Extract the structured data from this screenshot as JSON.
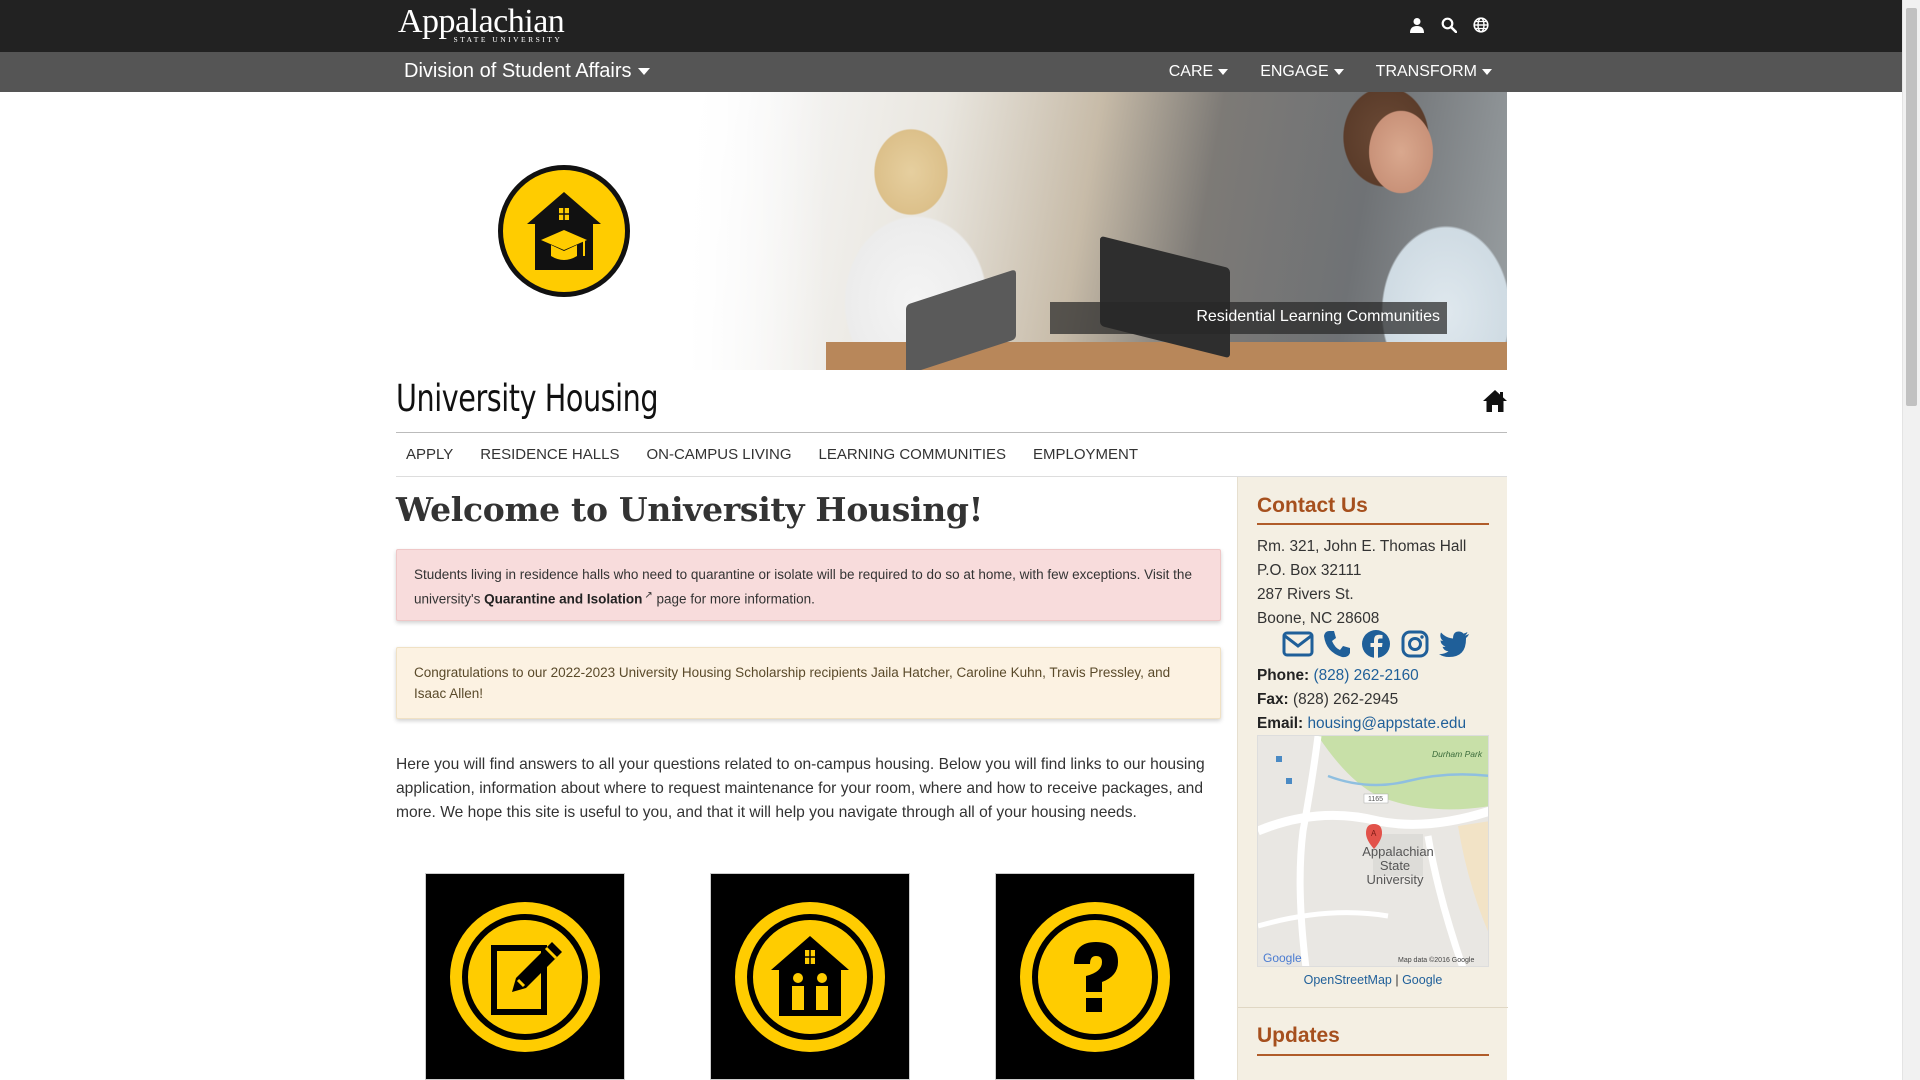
{
  "topbar": {
    "logo_text": "Appalachian",
    "logo_subtext": "STATE UNIVERSITY",
    "icons": [
      "user-icon",
      "search-icon",
      "globe-icon"
    ]
  },
  "division_bar": {
    "title": "Division of Student Affairs",
    "nav": [
      {
        "label": "CARE"
      },
      {
        "label": "ENGAGE"
      },
      {
        "label": "TRANSFORM"
      }
    ]
  },
  "banner": {
    "caption": "Residential Learning Communities"
  },
  "site": {
    "title": "University Housing"
  },
  "subnav": [
    {
      "label": "APPLY"
    },
    {
      "label": "RESIDENCE HALLS"
    },
    {
      "label": "ON-CAMPUS LIVING"
    },
    {
      "label": "LEARNING COMMUNITIES"
    },
    {
      "label": "EMPLOYMENT"
    }
  ],
  "main": {
    "heading": "Welcome to University Housing!",
    "alert_red": {
      "text_before": "Students living in residence halls who need to quarantine or isolate will be required to do so at home, with few exceptions. Visit the university's ",
      "link": "Quarantine and Isolation",
      "text_after": " page for more information."
    },
    "alert_yellow": {
      "text": "Congratulations to our 2022-2023 University Housing Scholarship recipients Jaila Hatcher, Caroline Kuhn, Travis Pressley, and Isaac Allen!"
    },
    "intro": "Here you will find answers to all your questions related to on-campus housing.  Below you will find links to our housing application, information about where to request maintenance for your room, where and how to receive packages, and more. We hope this site is useful to you, and that it will help you navigate through all of your housing needs.",
    "tiles": [
      "apply-tile-icon",
      "residence-tile-icon",
      "faq-tile-icon"
    ]
  },
  "sidebar": {
    "contact_heading": "Contact Us",
    "address": [
      "Rm. 321, John E. Thomas Hall",
      "P.O. Box 32111",
      "287 Rivers St.",
      "Boone, NC 28608"
    ],
    "phone_label": "Phone:",
    "phone": "(828) 262-2160",
    "fax_label": "Fax:",
    "fax": "(828) 262-2945",
    "email_label": "Email:",
    "email": "housing@appstate.edu",
    "map": {
      "label_park": "Durham Park",
      "label_marker": "A",
      "label_place_1": "Appalachian",
      "label_place_2": "State",
      "label_place_3": "University",
      "label_road_1": "1165",
      "label_brand": "Google",
      "label_data": "Map data ©2016 Google"
    },
    "map_links": [
      "OpenStreetMap",
      "Google"
    ],
    "map_links_sep": "|",
    "updates_heading": "Updates"
  },
  "colors": {
    "gold": "#ffcc00",
    "topbar": "#222222",
    "divbar": "#555555",
    "sidebar_heading": "#a6501e",
    "link": "#1f5f99"
  }
}
